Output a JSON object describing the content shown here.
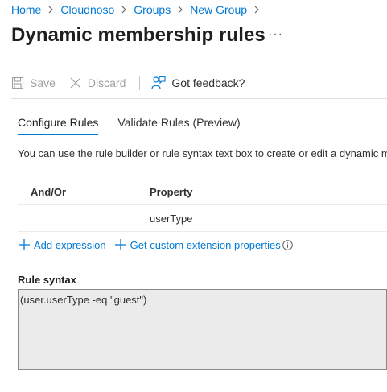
{
  "breadcrumb": [
    "Home",
    "Cloudnoso",
    "Groups",
    "New Group"
  ],
  "page": {
    "title": "Dynamic membership rules",
    "more": "···"
  },
  "toolbar": {
    "save": "Save",
    "discard": "Discard",
    "feedback": "Got feedback?"
  },
  "tabs": [
    {
      "label": "Configure Rules",
      "active": true
    },
    {
      "label": "Validate Rules (Preview)",
      "active": false
    }
  ],
  "description": "You can use the rule builder or rule syntax text box to create or edit a dynamic m",
  "rules_table": {
    "headers": [
      "And/Or",
      "Property"
    ],
    "rows": [
      {
        "and_or": "",
        "property": "userType"
      }
    ]
  },
  "actions": {
    "add_expression": "Add expression",
    "custom_extension": "Get custom extension properties"
  },
  "rule_syntax": {
    "label": "Rule syntax",
    "value": "(user.userType -eq \"guest\")"
  },
  "colors": {
    "accent": "#0078d4",
    "disabled": "#a19f9d",
    "text": "#323130",
    "syntax_bg": "#ebebeb"
  },
  "icons": [
    "chevron-right-icon",
    "save-icon",
    "discard-icon",
    "feedback-icon",
    "plus-icon",
    "info-icon"
  ]
}
